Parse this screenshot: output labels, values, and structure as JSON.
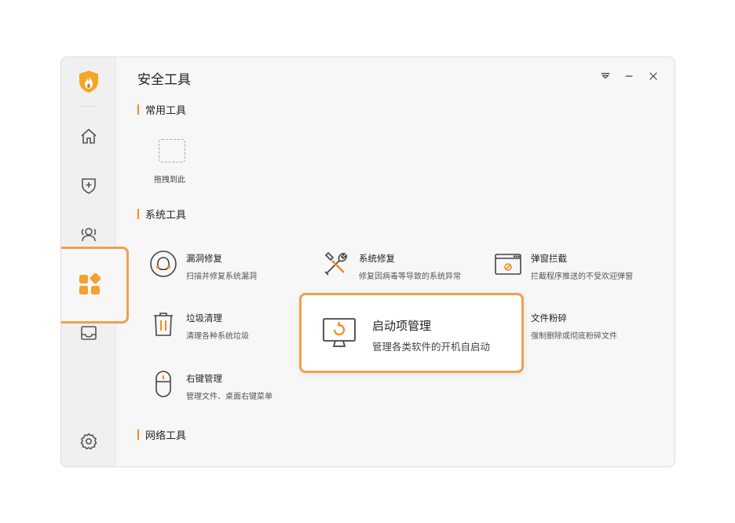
{
  "window": {
    "title": "安全工具"
  },
  "sidebar": {
    "items": [
      {
        "icon": "home-icon"
      },
      {
        "icon": "shield-plus-icon"
      },
      {
        "icon": "users-icon"
      },
      {
        "icon": "apps-icon",
        "active": true
      },
      {
        "icon": "inbox-icon"
      },
      {
        "icon": "gear-icon"
      }
    ]
  },
  "sections": {
    "common": "常用工具",
    "system": "系统工具",
    "network": "网络工具"
  },
  "common": {
    "drop_label": "拖拽到此"
  },
  "tools": [
    {
      "name": "漏洞修复",
      "desc": "扫描并修复系统漏洞",
      "icon": "vulnerability-icon"
    },
    {
      "name": "系统修复",
      "desc": "修复因病毒等导致的系统异常",
      "icon": "tools-icon"
    },
    {
      "name": "弹窗拦截",
      "desc": "拦截程序推送的不受欢迎弹窗",
      "icon": "popup-block-icon"
    },
    {
      "name": "垃圾清理",
      "desc": "清理各种系统垃圾",
      "icon": "trash-icon"
    },
    {
      "name": "启动项管理",
      "desc": "管理各类软件的开机自启动",
      "icon": "startup-monitor-icon"
    },
    {
      "name": "文件粉碎",
      "desc": "强制删除或彻底粉碎文件",
      "icon": "file-shred-icon"
    },
    {
      "name": "右键管理",
      "desc": "管理文件、桌面右键菜单",
      "icon": "mouse-icon"
    }
  ],
  "colors": {
    "accent": "#f08c1e",
    "highlight_border": "#f0a050"
  }
}
